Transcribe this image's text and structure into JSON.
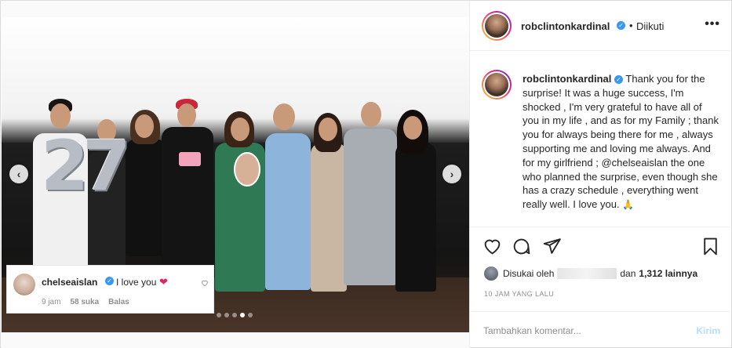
{
  "post": {
    "username": "robclintonkardinal",
    "follow_status": "Diikuti",
    "separator": "•",
    "more_icon": "more-options-icon"
  },
  "caption": {
    "username": "robclintonkardinal",
    "text_part1": "Thank you for the surprise! It was a huge success, I'm shocked , I'm very grateful to have all of you in my life , and as for my Family ; thank you for always being there for me , always supporting me and loving me always. And for my girlfriend ;",
    "mention": "@chelseaislan",
    "text_part2": "the one who planned the surprise, even though she has a crazy schedule , everything went really well. I love you.",
    "emoji": "🙏"
  },
  "comment_popup": {
    "username": "chelseaislan",
    "text": "I love you",
    "emoji": "❤",
    "time": "9 jam",
    "likes": "58 suka",
    "reply": "Balas"
  },
  "likes": {
    "prefix": "Disukai oleh",
    "middle": "dan",
    "count": "1,312 lainnya"
  },
  "timestamp": "10 JAM YANG LALU",
  "compose": {
    "placeholder": "Tambahkan komentar...",
    "send": "Kirim"
  },
  "carousel": {
    "total_slides": 5,
    "active_index": 3,
    "balloon_text": "27"
  },
  "colors": {
    "accent": "#3897f0",
    "heart": "#e0245e",
    "send_disabled": "#b2dffc",
    "muted": "#8e8e8e"
  }
}
